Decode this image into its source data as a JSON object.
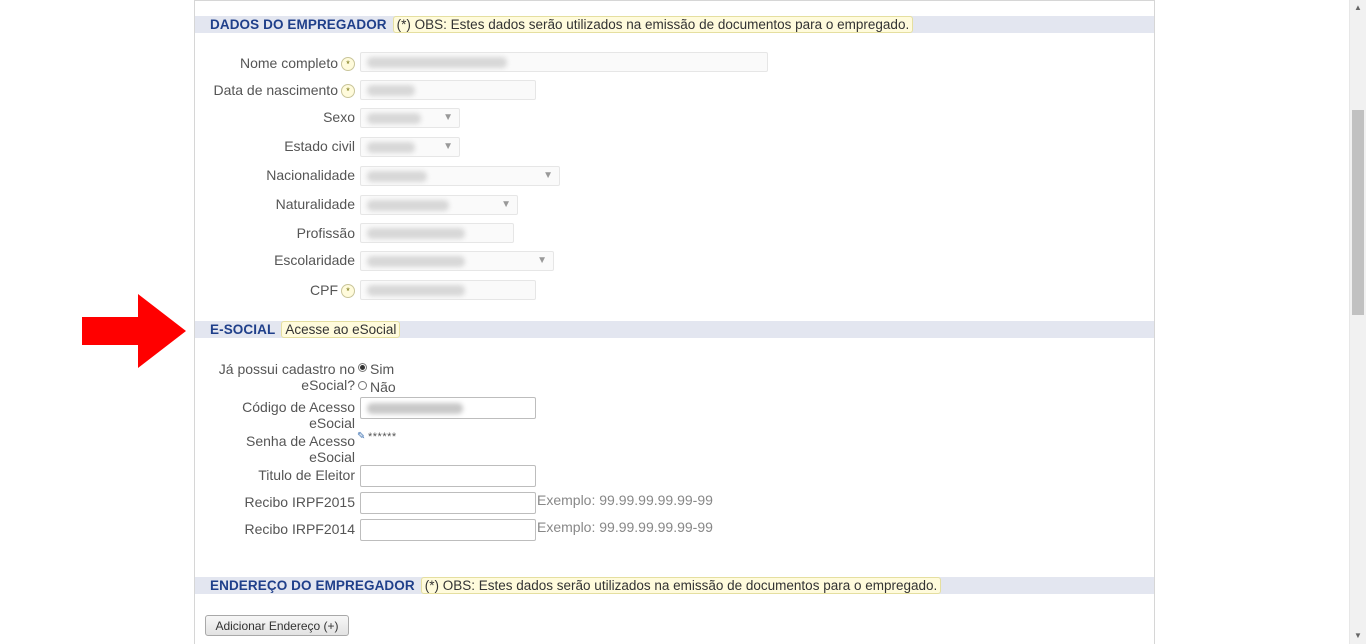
{
  "employer_section": {
    "title": "DADOS DO EMPREGADOR",
    "note": "(*) OBS: Estes dados serão utilizados na emissão de documentos para o empregado."
  },
  "required_mark": "(*)",
  "fields": {
    "nome_completo": "Nome completo",
    "data_nascimento": "Data de nascimento",
    "sexo": "Sexo",
    "estado_civil": "Estado civil",
    "nacionalidade": "Nacionalidade",
    "naturalidade": "Naturalidade",
    "profissao": "Profissão",
    "escolaridade": "Escolaridade",
    "cpf": "CPF"
  },
  "esocial_section": {
    "title": "E-SOCIAL",
    "link": "Acesse ao eSocial",
    "cadastro_label": "Já possui cadastro no eSocial?",
    "option_sim": "Sim",
    "option_nao": "Não",
    "selected": "Sim",
    "codigo_label": "Código de Acesso eSocial",
    "senha_label": "Senha de Acesso eSocial",
    "senha_value": "******",
    "titulo_label": "Titulo de Eleitor",
    "irpf2015_label": "Recibo IRPF2015",
    "irpf2014_label": "Recibo IRPF2014",
    "irpf_example": "Exemplo: 99.99.99.99.99-99"
  },
  "address_section": {
    "title": "ENDEREÇO DO EMPREGADOR",
    "note": "(*) OBS: Estes dados serão utilizados na emissão de documentos para o empregado.",
    "add_button": "Adicionar Endereço (+)"
  },
  "icons": {
    "pointer": "red-arrow-icon",
    "edit": "pencil-icon"
  },
  "colors": {
    "section_title": "#1f3f8a",
    "section_bg": "#e3e6f0",
    "note_bg": "#fffbdc",
    "arrow": "#ff0000"
  }
}
